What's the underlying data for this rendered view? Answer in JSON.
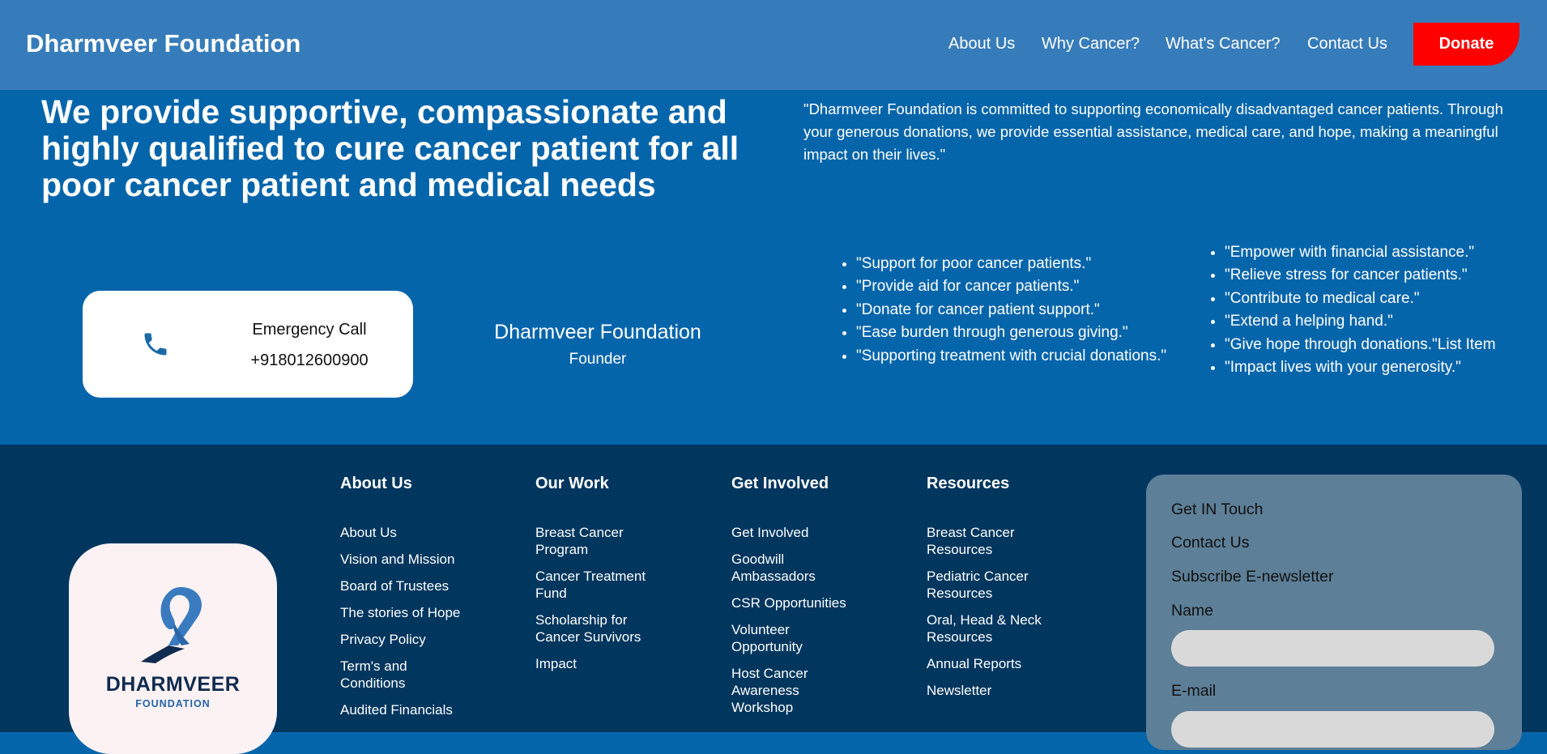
{
  "navbar": {
    "brand": "Dharmveer Foundation",
    "links": [
      "About Us",
      "Why Cancer?",
      "What's Cancer?",
      "Contact Us"
    ],
    "donate_label": "Donate"
  },
  "hero": {
    "title": "We provide supportive, compassionate and highly qualified to cure cancer patient for all poor cancer patient and medical needs",
    "quote": "\"Dharmveer Foundation is committed to supporting economically disadvantaged cancer patients. Through your generous donations, we provide essential assistance, medical care, and hope, making a meaningful impact on their lives.\"",
    "emergency": {
      "label": "Emergency Call",
      "number": "+918012600900"
    },
    "founder": {
      "name": "Dharmveer Foundation",
      "role": "Founder"
    },
    "list_left": [
      "\"Support for poor cancer patients.\"",
      "\"Provide aid for cancer patients.\"",
      "\"Donate for cancer patient support.\"",
      "\"Ease burden through generous giving.\"",
      "\"Supporting treatment with crucial donations.\""
    ],
    "list_right": [
      "\"Empower with financial assistance.\"",
      "\"Relieve stress for cancer patients.\"",
      "\"Contribute to medical care.\"",
      "\"Extend a helping hand.\"",
      "\"Give hope through donations.\"List Item",
      "\"Impact lives with your generosity.\""
    ]
  },
  "footer": {
    "logo": {
      "line1": "DHARMVEER",
      "line2": "FOUNDATION"
    },
    "columns": [
      {
        "title": "About Us",
        "links": [
          "About Us",
          "Vision and Mission",
          "Board of Trustees",
          "The stories of Hope",
          "Privacy Policy",
          "Term's and Conditions",
          "Audited Financials"
        ]
      },
      {
        "title": "Our Work",
        "links": [
          "Breast Cancer Program",
          "Cancer Treatment Fund",
          "Scholarship for Cancer Survivors",
          "Impact"
        ]
      },
      {
        "title": "Get Involved",
        "links": [
          "Get Involved",
          "Goodwill Ambassadors",
          "CSR Opportunities",
          "Volunteer Opportunity",
          "Host Cancer Awareness Workshop"
        ]
      },
      {
        "title": "Resources",
        "links": [
          "Breast Cancer Resources",
          "Pediatric Cancer Resources",
          "Oral, Head & Neck Resources",
          "Annual Reports",
          "Newsletter"
        ]
      }
    ],
    "touch": {
      "items": [
        "Get IN Touch",
        "Contact Us",
        "Subscribe E-newsletter"
      ],
      "name_label": "Name",
      "email_label": "E-mail"
    }
  },
  "colors": {
    "navbar": "#377cba",
    "hero": "#0565ab",
    "footer": "#01365e",
    "donate": "#ff0000",
    "touch_panel": "#5d7f97"
  }
}
